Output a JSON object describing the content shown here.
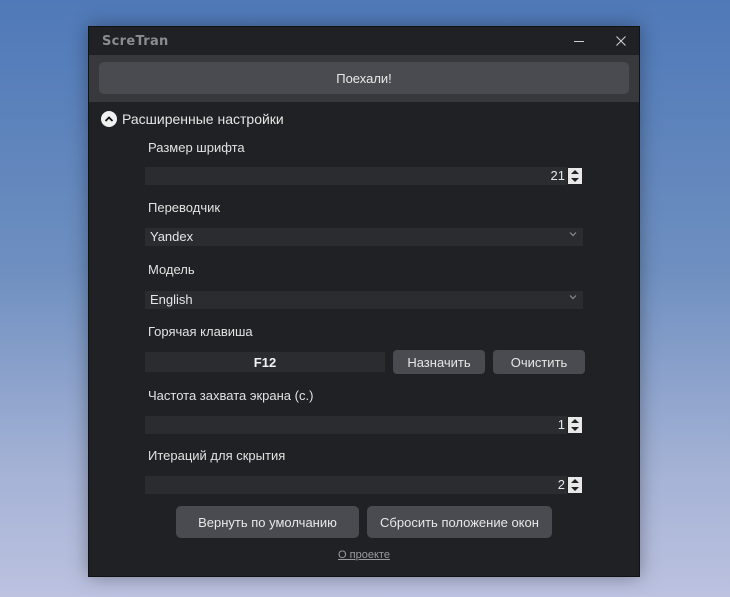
{
  "window": {
    "title": "ScreTran"
  },
  "toolbar": {
    "go_label": "Поехали!"
  },
  "advanced": {
    "toggle_label": "Расширенные настройки"
  },
  "settings": {
    "font_size": {
      "label": "Размер шрифта",
      "value": "21"
    },
    "translator": {
      "label": "Переводчик",
      "value": "Yandex"
    },
    "model": {
      "label": "Модель",
      "value": "English"
    },
    "hotkey": {
      "label": "Горячая клавиша",
      "value": "F12",
      "assign_label": "Назначить",
      "clear_label": "Очистить"
    },
    "capture_rate": {
      "label": "Частота захвата экрана (с.)",
      "value": "1"
    },
    "hide_iterations": {
      "label": "Итераций для скрытия",
      "value": "2"
    }
  },
  "footer": {
    "reset_defaults_label": "Вернуть по умолчанию",
    "reset_positions_label": "Сбросить положение окон",
    "about_label": "О проекте"
  },
  "icons": {
    "minimize": "minimize-icon",
    "close": "close-icon",
    "collapse": "chevron-up-icon",
    "dropdown": "chevron-down-icon",
    "spin": "spin-arrows-icon"
  },
  "colors": {
    "window_bg": "#202124",
    "button_bg": "#4a4b50",
    "field_bg": "#2b2c30",
    "text": "#e6e6e6"
  }
}
